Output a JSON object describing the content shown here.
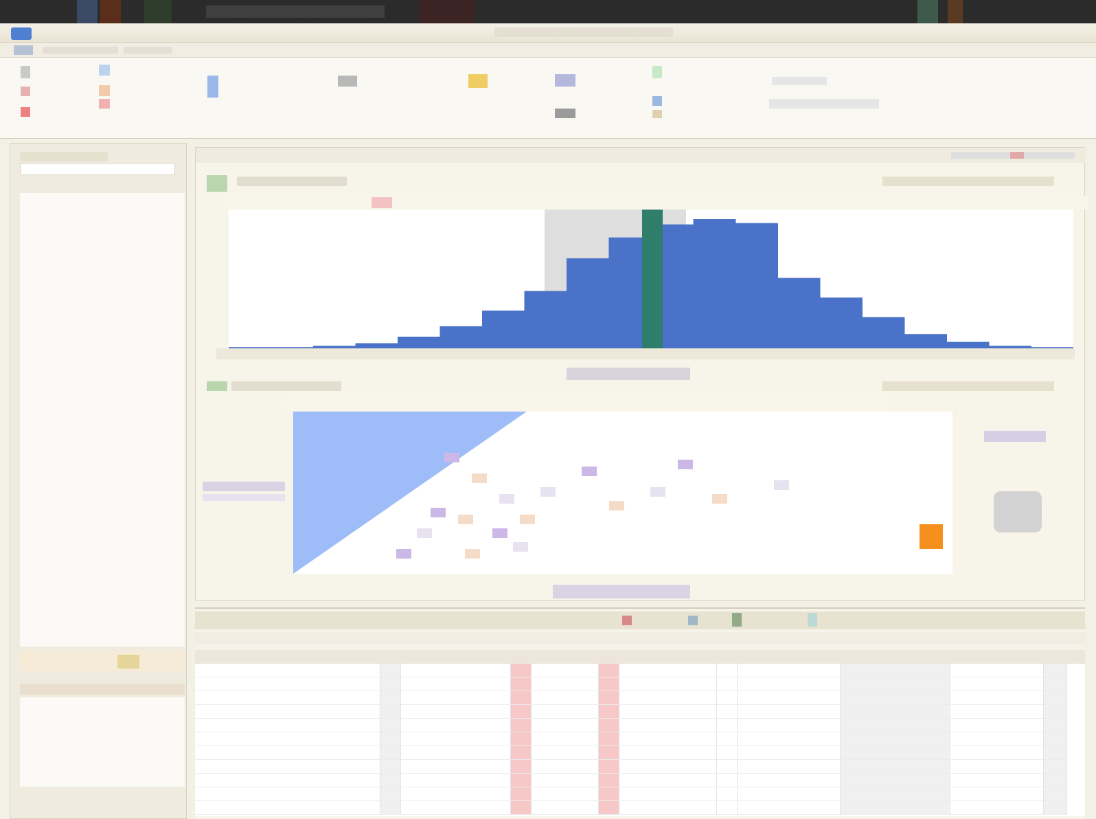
{
  "window": {
    "title": "",
    "app_icon": "app-icon"
  },
  "menu": [],
  "toolbar": {
    "groups": []
  },
  "left_panel": {
    "header": "",
    "search_placeholder": "",
    "items": []
  },
  "viewer": {
    "tabs": [],
    "spectrum": {
      "fill_color": "#4a72c8",
      "highlight_color": "#2f7d6b",
      "selected_range_color": "#c8c8c8",
      "fraction_profile": [
        0.02,
        0.02,
        0.03,
        0.05,
        0.1,
        0.18,
        0.3,
        0.45,
        0.7,
        0.86,
        0.96,
        1.0,
        0.97,
        0.55,
        0.4,
        0.25,
        0.12,
        0.06,
        0.03,
        0.02
      ]
    },
    "image_view": {
      "primary_color": "#9ebcf8",
      "accent_color": "#f5901e"
    }
  },
  "table": {
    "headers": [],
    "rows": [],
    "highlight_column_color": "#f6c8c8"
  }
}
